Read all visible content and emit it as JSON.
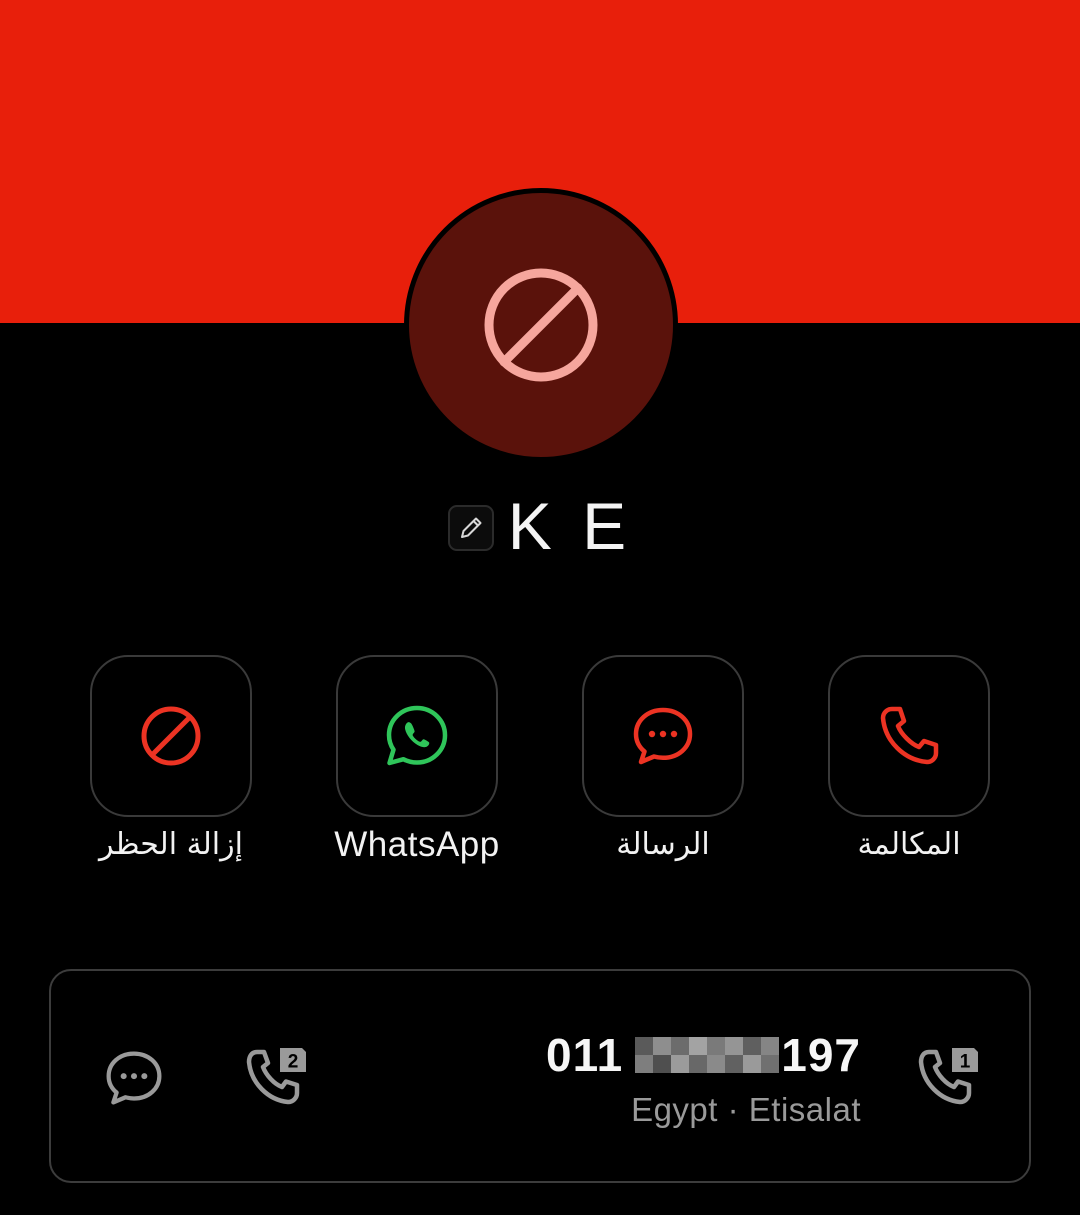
{
  "colors": {
    "banner": "#e81f0b",
    "avatar_bg": "#5a120b",
    "avatar_icon": "#f6a69d",
    "accent_red": "#ec3323",
    "whatsapp_green": "#2fc55a",
    "muted_icon": "#9a9a9a"
  },
  "contact": {
    "name": "K E",
    "avatar_icon": "block-icon",
    "edit_icon": "pencil-icon"
  },
  "actions": [
    {
      "icon": "block-icon",
      "label": "إزالة الحظر"
    },
    {
      "icon": "whatsapp-icon",
      "label": "WhatsApp"
    },
    {
      "icon": "message-icon",
      "label": "الرسالة"
    },
    {
      "icon": "phone-icon",
      "label": "المكالمة"
    }
  ],
  "number_card": {
    "number_prefix": "011",
    "number_suffix": "197",
    "number_middle_redacted": true,
    "carrier": "Egypt · Etisalat",
    "left_icons": [
      "message-icon",
      "sim2-call-icon"
    ],
    "right_icon": "sim1-call-icon",
    "sim2_label": "2",
    "sim1_label": "1"
  }
}
